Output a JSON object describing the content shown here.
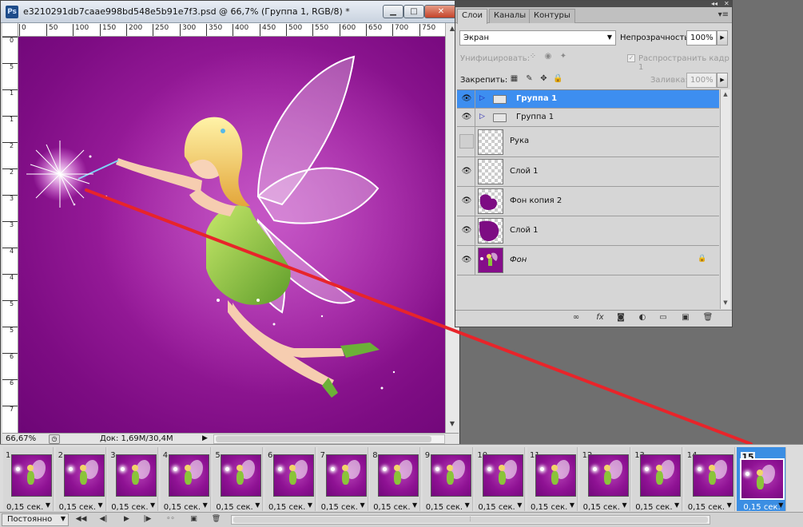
{
  "document": {
    "ps_badge": "Ps",
    "title": "e3210291db7caae998bd548e5b91e7f3.psd @ 66,7% (Группа 1, RGB/8) *",
    "window_buttons": {
      "minimize": "▁",
      "maximize": "□",
      "close": "✕"
    },
    "ruler_top": [
      "0",
      "50",
      "100",
      "150",
      "200",
      "250",
      "300",
      "350",
      "400",
      "450",
      "500",
      "550",
      "600",
      "650",
      "700",
      "750"
    ],
    "ruler_left": [
      "0",
      "5",
      "1",
      "1",
      "2",
      "2",
      "3",
      "3",
      "4",
      "4",
      "5",
      "5",
      "6",
      "6",
      "7",
      "7"
    ],
    "status": {
      "zoom": "66,67%",
      "doc_size": "Док: 1,69M/30,4M",
      "arrow": "▶"
    }
  },
  "layers_panel": {
    "header_controls": {
      "collapse": "◂◂",
      "close": "✕"
    },
    "tabs": [
      "Слои",
      "Каналы",
      "Контуры"
    ],
    "active_tab": 0,
    "menu_icon": "▾≡",
    "blend_mode": "Экран",
    "opacity_label": "Непрозрачность:",
    "opacity": "100%",
    "unify_label": "Унифицировать:",
    "propagate_label": "Распространить кадр 1",
    "lock_label": "Закрепить:",
    "fill_label": "Заливка:",
    "fill": "100%",
    "layers": [
      {
        "name": "Группа 1",
        "type": "group",
        "visible": true,
        "selected": true
      },
      {
        "name": "Группа 1",
        "type": "group",
        "visible": true,
        "selected": false
      },
      {
        "name": "Рука",
        "type": "layer",
        "visible": false,
        "selected": false,
        "thumb": "transparent"
      },
      {
        "name": "Слой 1",
        "type": "layer",
        "visible": true,
        "selected": false,
        "thumb": "transparent"
      },
      {
        "name": "Фон копия 2",
        "type": "layer",
        "visible": true,
        "selected": false,
        "thumb": "purple-blob"
      },
      {
        "name": "Слой 1",
        "type": "layer",
        "visible": true,
        "selected": false,
        "thumb": "purple-blob"
      },
      {
        "name": "Фон",
        "type": "background",
        "visible": true,
        "selected": false,
        "locked": true,
        "thumb": "fairy"
      }
    ],
    "footer_icons": [
      "link-icon",
      "fx-icon",
      "mask-icon",
      "adjustment-icon",
      "group-icon",
      "new-layer-icon",
      "trash-icon"
    ],
    "footer_glyphs": [
      "∞",
      "fx",
      "◙",
      "◐",
      "▭",
      "▣",
      "🗑"
    ]
  },
  "animation": {
    "frames": [
      {
        "num": "1",
        "delay": "0,15 сек."
      },
      {
        "num": "2",
        "delay": "0,15 сек."
      },
      {
        "num": "3",
        "delay": "0,15 сек."
      },
      {
        "num": "4",
        "delay": "0,15 сек."
      },
      {
        "num": "5",
        "delay": "0,15 сек."
      },
      {
        "num": "6",
        "delay": "0,15 сек."
      },
      {
        "num": "7",
        "delay": "0,15 сек."
      },
      {
        "num": "8",
        "delay": "0,15 сек."
      },
      {
        "num": "9",
        "delay": "0,15 сек."
      },
      {
        "num": "10",
        "delay": "0,15 сек."
      },
      {
        "num": "11",
        "delay": "0,15 сек."
      },
      {
        "num": "12",
        "delay": "0,15 сек."
      },
      {
        "num": "13",
        "delay": "0,15 сек."
      },
      {
        "num": "14",
        "delay": "0,15 сек."
      },
      {
        "num": "15",
        "delay": "0,15 сек."
      }
    ],
    "selected_frame": "15",
    "loop": "Постоянно",
    "toolbar_glyphs": {
      "first": "◀◀",
      "prev": "◀|",
      "play": "▶",
      "next": "|▶",
      "tween": "◦◦",
      "duplicate": "▣",
      "delete": "🗑"
    }
  },
  "colors": {
    "canvas": "#8a1490",
    "selection": "#3d8ef0",
    "annotation_arrow": "#e8242a"
  }
}
